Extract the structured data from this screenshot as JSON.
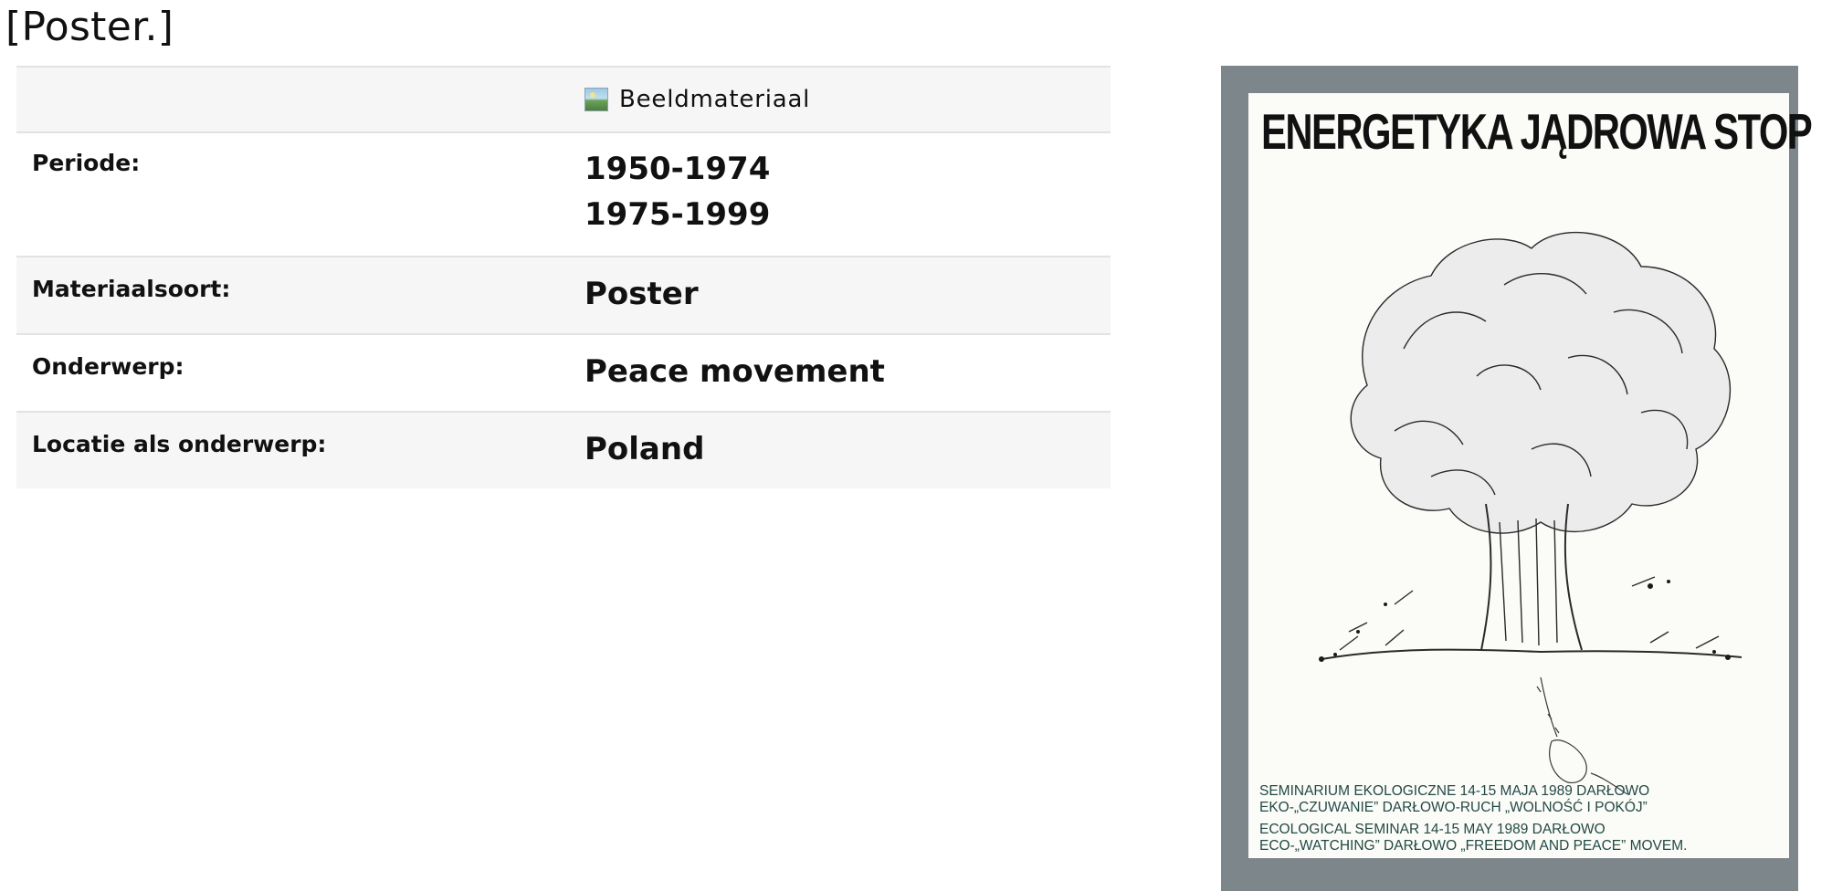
{
  "page": {
    "title": "[Poster.]"
  },
  "meta": {
    "type_label": "Beeldmateriaal",
    "type_icon": "image-icon",
    "rows": [
      {
        "label": "Periode:",
        "values": [
          "1950-1974",
          "1975-1999"
        ]
      },
      {
        "label": "Materiaalsoort:",
        "values": [
          "Poster"
        ]
      },
      {
        "label": "Onderwerp:",
        "values": [
          "Peace movement"
        ]
      },
      {
        "label": "Locatie als onderwerp:",
        "values": [
          "Poland"
        ]
      }
    ]
  },
  "poster": {
    "headline": "ENERGETYKA JĄDROWA STOP",
    "lines": [
      "SEMINARIUM EKOLOGICZNE 14-15 MAJA 1989 DARŁOWO",
      "EKO-„CZUWANIE” DARŁOWO-RUCH „WOLNOŚĆ I POKÓJ”",
      "ECOLOGICAL SEMINAR 14-15    MAY 1989 DARŁOWO",
      "ECO-„WATCHING” DARŁOWO „FREEDOM AND PEACE” MOVEM."
    ]
  },
  "colors": {
    "row_alt": "#f6f6f6",
    "border": "#e2e2e2",
    "poster_frame": "#7d868b",
    "poster_text": "#234a46"
  }
}
